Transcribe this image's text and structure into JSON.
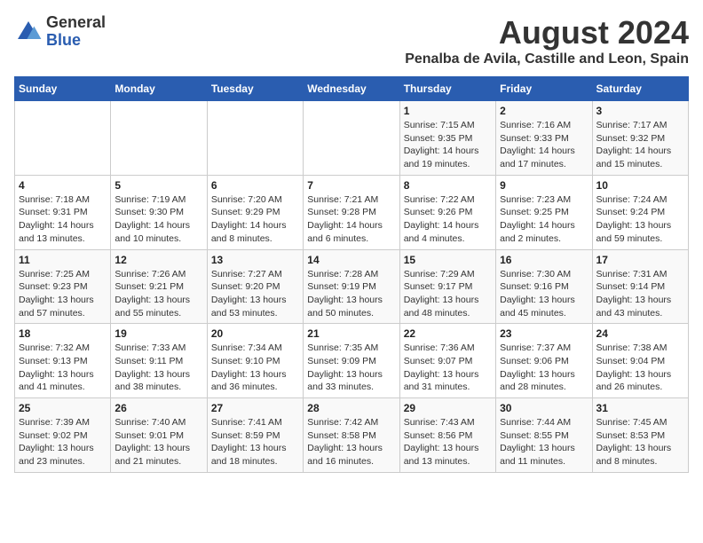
{
  "header": {
    "logo_line1": "General",
    "logo_line2": "Blue",
    "main_title": "August 2024",
    "subtitle": "Penalba de Avila, Castille and Leon, Spain"
  },
  "calendar": {
    "days_of_week": [
      "Sunday",
      "Monday",
      "Tuesday",
      "Wednesday",
      "Thursday",
      "Friday",
      "Saturday"
    ],
    "weeks": [
      [
        {
          "day": "",
          "detail": ""
        },
        {
          "day": "",
          "detail": ""
        },
        {
          "day": "",
          "detail": ""
        },
        {
          "day": "",
          "detail": ""
        },
        {
          "day": "1",
          "detail": "Sunrise: 7:15 AM\nSunset: 9:35 PM\nDaylight: 14 hours\nand 19 minutes."
        },
        {
          "day": "2",
          "detail": "Sunrise: 7:16 AM\nSunset: 9:33 PM\nDaylight: 14 hours\nand 17 minutes."
        },
        {
          "day": "3",
          "detail": "Sunrise: 7:17 AM\nSunset: 9:32 PM\nDaylight: 14 hours\nand 15 minutes."
        }
      ],
      [
        {
          "day": "4",
          "detail": "Sunrise: 7:18 AM\nSunset: 9:31 PM\nDaylight: 14 hours\nand 13 minutes."
        },
        {
          "day": "5",
          "detail": "Sunrise: 7:19 AM\nSunset: 9:30 PM\nDaylight: 14 hours\nand 10 minutes."
        },
        {
          "day": "6",
          "detail": "Sunrise: 7:20 AM\nSunset: 9:29 PM\nDaylight: 14 hours\nand 8 minutes."
        },
        {
          "day": "7",
          "detail": "Sunrise: 7:21 AM\nSunset: 9:28 PM\nDaylight: 14 hours\nand 6 minutes."
        },
        {
          "day": "8",
          "detail": "Sunrise: 7:22 AM\nSunset: 9:26 PM\nDaylight: 14 hours\nand 4 minutes."
        },
        {
          "day": "9",
          "detail": "Sunrise: 7:23 AM\nSunset: 9:25 PM\nDaylight: 14 hours\nand 2 minutes."
        },
        {
          "day": "10",
          "detail": "Sunrise: 7:24 AM\nSunset: 9:24 PM\nDaylight: 13 hours\nand 59 minutes."
        }
      ],
      [
        {
          "day": "11",
          "detail": "Sunrise: 7:25 AM\nSunset: 9:23 PM\nDaylight: 13 hours\nand 57 minutes."
        },
        {
          "day": "12",
          "detail": "Sunrise: 7:26 AM\nSunset: 9:21 PM\nDaylight: 13 hours\nand 55 minutes."
        },
        {
          "day": "13",
          "detail": "Sunrise: 7:27 AM\nSunset: 9:20 PM\nDaylight: 13 hours\nand 53 minutes."
        },
        {
          "day": "14",
          "detail": "Sunrise: 7:28 AM\nSunset: 9:19 PM\nDaylight: 13 hours\nand 50 minutes."
        },
        {
          "day": "15",
          "detail": "Sunrise: 7:29 AM\nSunset: 9:17 PM\nDaylight: 13 hours\nand 48 minutes."
        },
        {
          "day": "16",
          "detail": "Sunrise: 7:30 AM\nSunset: 9:16 PM\nDaylight: 13 hours\nand 45 minutes."
        },
        {
          "day": "17",
          "detail": "Sunrise: 7:31 AM\nSunset: 9:14 PM\nDaylight: 13 hours\nand 43 minutes."
        }
      ],
      [
        {
          "day": "18",
          "detail": "Sunrise: 7:32 AM\nSunset: 9:13 PM\nDaylight: 13 hours\nand 41 minutes."
        },
        {
          "day": "19",
          "detail": "Sunrise: 7:33 AM\nSunset: 9:11 PM\nDaylight: 13 hours\nand 38 minutes."
        },
        {
          "day": "20",
          "detail": "Sunrise: 7:34 AM\nSunset: 9:10 PM\nDaylight: 13 hours\nand 36 minutes."
        },
        {
          "day": "21",
          "detail": "Sunrise: 7:35 AM\nSunset: 9:09 PM\nDaylight: 13 hours\nand 33 minutes."
        },
        {
          "day": "22",
          "detail": "Sunrise: 7:36 AM\nSunset: 9:07 PM\nDaylight: 13 hours\nand 31 minutes."
        },
        {
          "day": "23",
          "detail": "Sunrise: 7:37 AM\nSunset: 9:06 PM\nDaylight: 13 hours\nand 28 minutes."
        },
        {
          "day": "24",
          "detail": "Sunrise: 7:38 AM\nSunset: 9:04 PM\nDaylight: 13 hours\nand 26 minutes."
        }
      ],
      [
        {
          "day": "25",
          "detail": "Sunrise: 7:39 AM\nSunset: 9:02 PM\nDaylight: 13 hours\nand 23 minutes."
        },
        {
          "day": "26",
          "detail": "Sunrise: 7:40 AM\nSunset: 9:01 PM\nDaylight: 13 hours\nand 21 minutes."
        },
        {
          "day": "27",
          "detail": "Sunrise: 7:41 AM\nSunset: 8:59 PM\nDaylight: 13 hours\nand 18 minutes."
        },
        {
          "day": "28",
          "detail": "Sunrise: 7:42 AM\nSunset: 8:58 PM\nDaylight: 13 hours\nand 16 minutes."
        },
        {
          "day": "29",
          "detail": "Sunrise: 7:43 AM\nSunset: 8:56 PM\nDaylight: 13 hours\nand 13 minutes."
        },
        {
          "day": "30",
          "detail": "Sunrise: 7:44 AM\nSunset: 8:55 PM\nDaylight: 13 hours\nand 11 minutes."
        },
        {
          "day": "31",
          "detail": "Sunrise: 7:45 AM\nSunset: 8:53 PM\nDaylight: 13 hours\nand 8 minutes."
        }
      ]
    ]
  }
}
